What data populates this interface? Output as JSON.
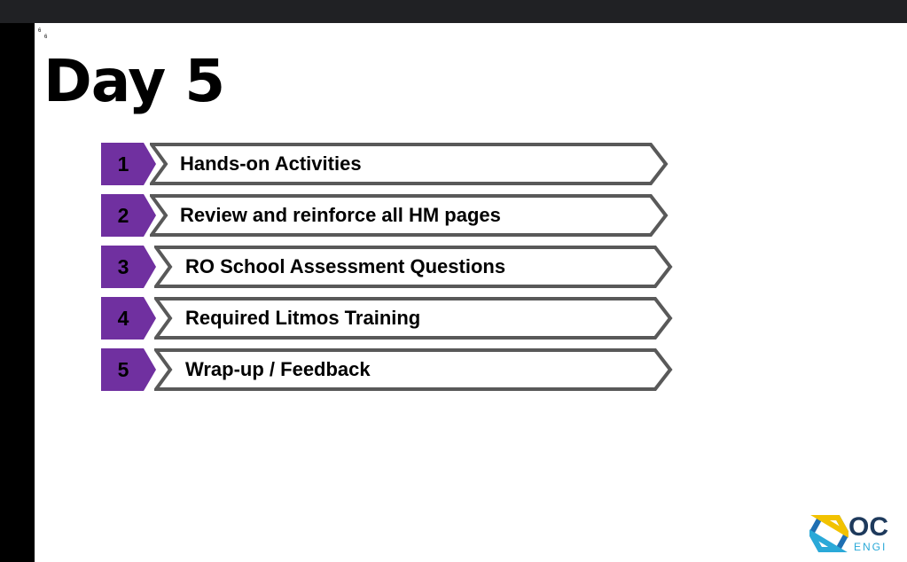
{
  "window": {
    "background": "#202124"
  },
  "slide": {
    "marker_top": "6",
    "marker_bottom": "6",
    "title": "Day 5",
    "accent_color": "#7030a0",
    "outline_color": "#595959",
    "agenda": [
      {
        "number": "1",
        "text": "Hands-on Activities"
      },
      {
        "number": "2",
        "text": "Review and reinforce all HM pages"
      },
      {
        "number": "3",
        "text": "RO School Assessment Questions"
      },
      {
        "number": "4",
        "text": "Required Litmos Training"
      },
      {
        "number": "5",
        "text": "Wrap-up / Feedback"
      }
    ],
    "logo": {
      "text_top": "OC",
      "text_bottom": "ENGI",
      "icon": "hexagon-logo-icon"
    }
  }
}
